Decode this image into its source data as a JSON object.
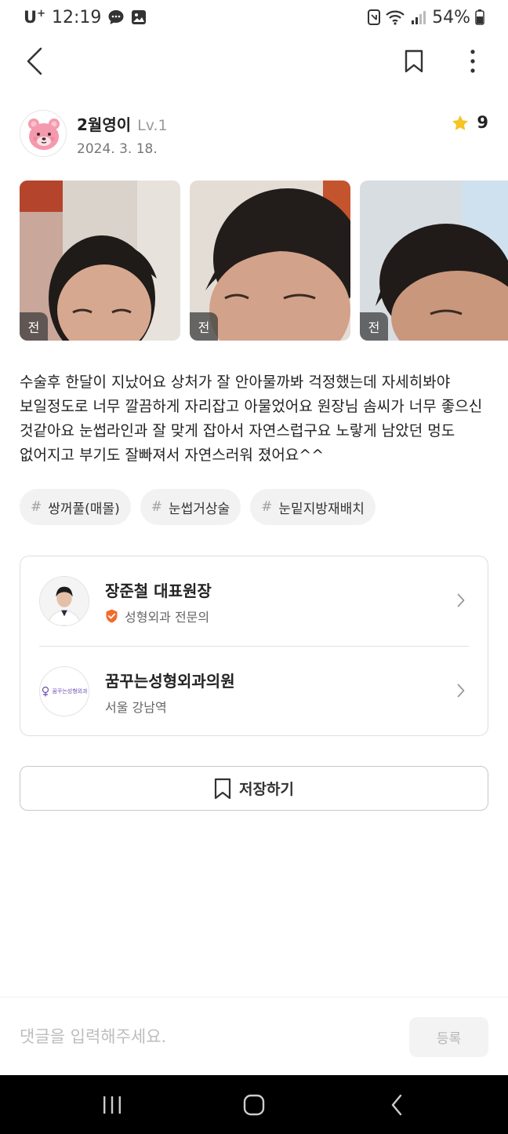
{
  "status_bar": {
    "carrier": "U",
    "carrier_sup": "+",
    "time": "12:19",
    "battery": "54%"
  },
  "author": {
    "name": "2월영이",
    "level": "Lv.1",
    "date": "2024. 3. 18.",
    "rating": "9"
  },
  "photos": [
    {
      "badge": "전"
    },
    {
      "badge": "전"
    },
    {
      "badge": "전"
    }
  ],
  "review": {
    "text": "수술후 한달이 지났어요 상처가 잘 안아물까봐 걱정했는데 자세히봐야 보일정도로 너무 깔끔하게 자리잡고 아물었어요 원장님 솜씨가 너무 좋으신 것같아요 눈썹라인과 잘 맞게 잡아서 자연스럽구요 노랗게 남았던 멍도 없어지고 부기도 잘빠져서 자연스러워 졌어요^^"
  },
  "tags": [
    {
      "hash": "#",
      "label": "쌍꺼풀(매몰)"
    },
    {
      "hash": "#",
      "label": "눈썹거상술"
    },
    {
      "hash": "#",
      "label": "눈밑지방재배치"
    }
  ],
  "doctor": {
    "name": "장준철 대표원장",
    "specialty": "성형외과 전문의"
  },
  "clinic": {
    "name": "꿈꾸는성형외과의원",
    "location": "서울 강남역",
    "logo_text": "꿈꾸는성형외과"
  },
  "save_button": {
    "label": "저장하기"
  },
  "comment": {
    "placeholder": "댓글을 입력해주세요.",
    "submit_label": "등록"
  },
  "colors": {
    "star": "#F7C325",
    "verified": "#F26B2B",
    "avatar_pink": "#F59AAE"
  }
}
